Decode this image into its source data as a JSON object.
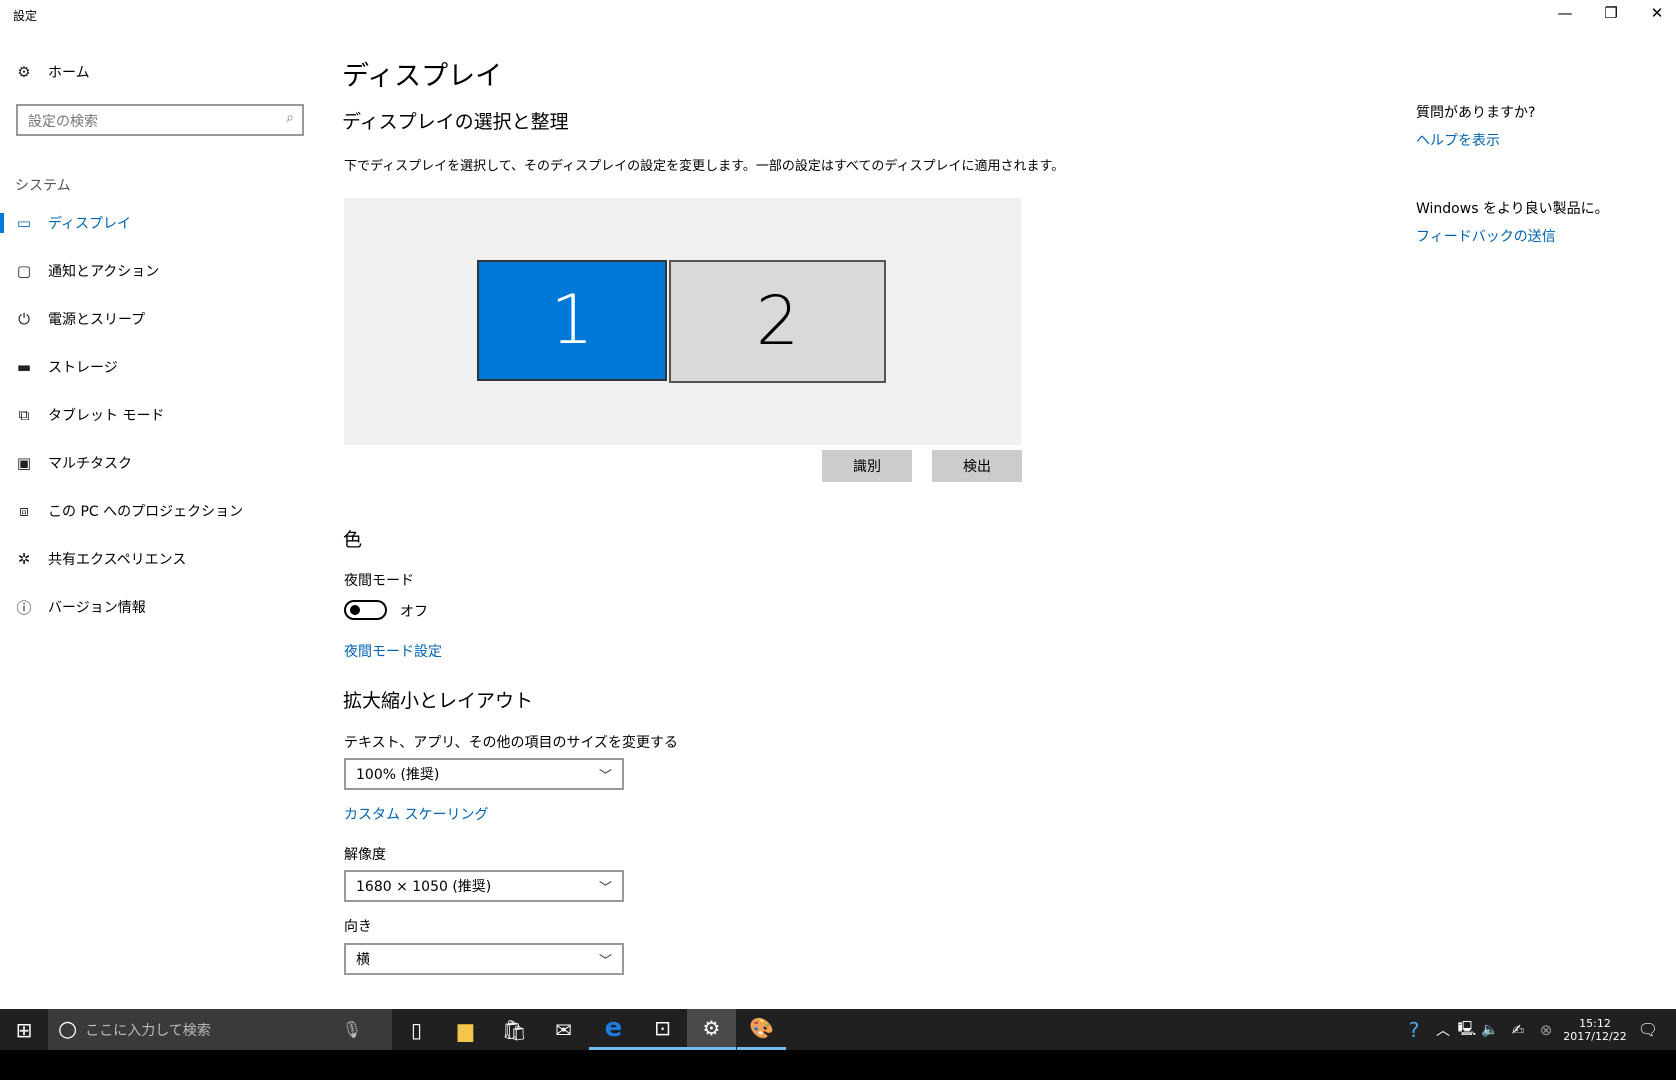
{
  "window": {
    "title": "設定",
    "minimize": "—",
    "maximize": "❐",
    "close": "✕"
  },
  "sidebar": {
    "home": "ホーム",
    "search_placeholder": "設定の検索",
    "section": "システム",
    "items": [
      {
        "label": "ディスプレイ",
        "icon": "monitor-icon"
      },
      {
        "label": "通知とアクション",
        "icon": "notification-icon"
      },
      {
        "label": "電源とスリープ",
        "icon": "power-icon"
      },
      {
        "label": "ストレージ",
        "icon": "storage-icon"
      },
      {
        "label": "タブレット モード",
        "icon": "tablet-icon"
      },
      {
        "label": "マルチタスク",
        "icon": "multitask-icon"
      },
      {
        "label": "この PC へのプロジェクション",
        "icon": "projection-icon"
      },
      {
        "label": "共有エクスペリエンス",
        "icon": "share-icon"
      },
      {
        "label": "バージョン情報",
        "icon": "info-icon"
      }
    ]
  },
  "main": {
    "title": "ディスプレイ",
    "arrange_heading": "ディスプレイの選択と整理",
    "description": "下でディスプレイを選択して、そのディスプレイの設定を変更します。一部の設定はすべてのディスプレイに適用されます。",
    "monitors": [
      "1",
      "2"
    ],
    "identify": "識別",
    "detect": "検出",
    "color_heading": "色",
    "night_label": "夜間モード",
    "night_state": "オフ",
    "night_on": false,
    "night_settings": "夜間モード設定",
    "scale_heading": "拡大縮小とレイアウト",
    "scale_label": "テキスト、アプリ、その他の項目のサイズを変更する",
    "scale_value": "100% (推奨)",
    "custom_scaling": "カスタム スケーリング",
    "resolution_label": "解像度",
    "resolution_value": "1680 × 1050 (推奨)",
    "orientation_label": "向き",
    "orientation_value": "横"
  },
  "aside": {
    "question": "質問がありますか?",
    "help": "ヘルプを表示",
    "better": "Windows をより良い製品に。",
    "feedback": "フィードバックの送信"
  },
  "taskbar": {
    "search_placeholder": "ここに入力して検索",
    "time": "15:12",
    "date": "2017/12/22"
  },
  "colors": {
    "accent": "#0078d7",
    "link": "#0063b1",
    "taskbar": "#202020"
  }
}
